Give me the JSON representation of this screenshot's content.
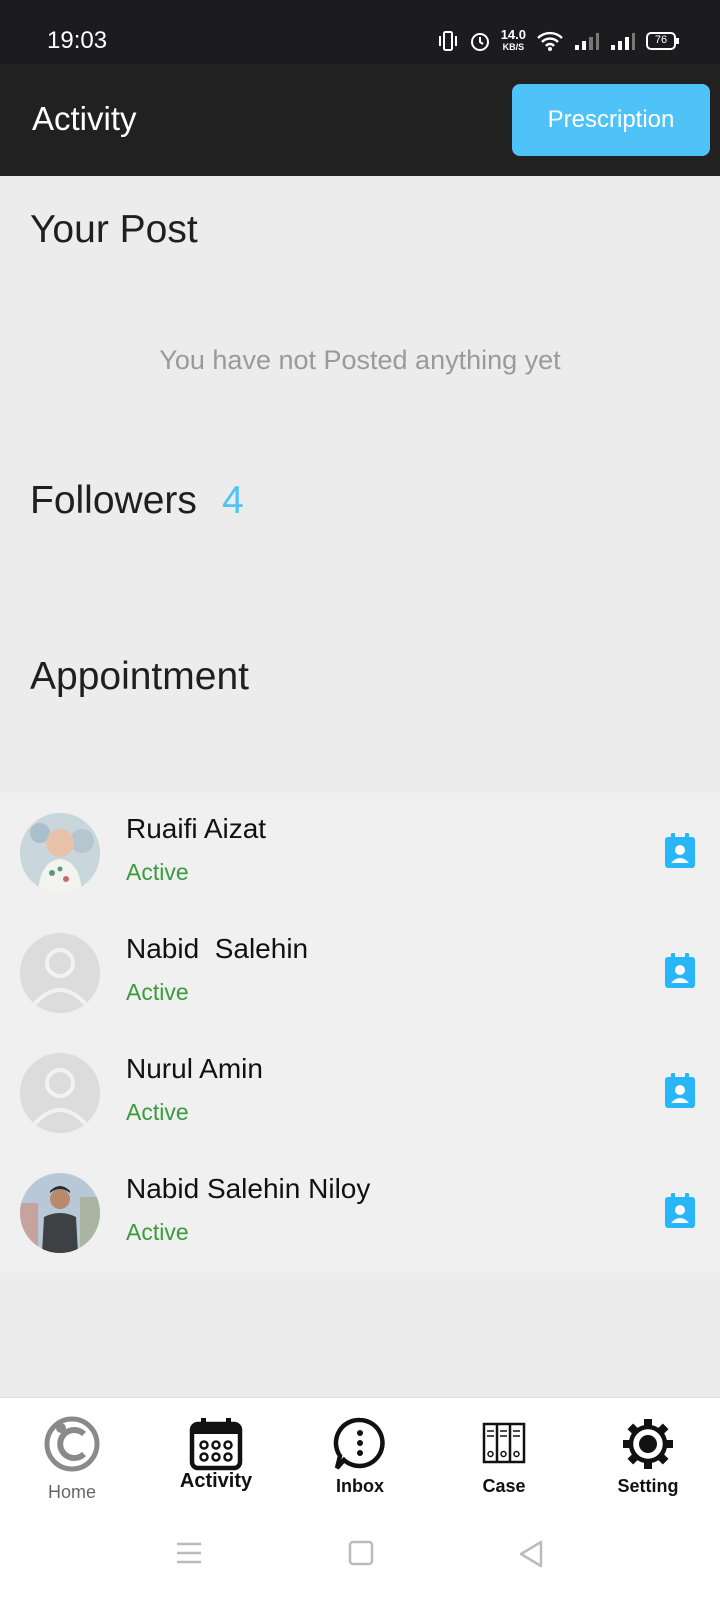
{
  "status_bar": {
    "time": "19:03",
    "net_speed_value": "14.0",
    "net_speed_unit": "KB/S",
    "battery": "76",
    "icons": [
      "vibrate-icon",
      "alarm-icon",
      "wifi-icon",
      "signal-icon",
      "signal-icon",
      "battery-icon"
    ]
  },
  "app_bar": {
    "title": "Activity",
    "prescription_label": "Prescription"
  },
  "your_post": {
    "title": "Your Post",
    "empty_message": "You have not Posted anything yet"
  },
  "followers": {
    "title": "Followers",
    "count": "4"
  },
  "appointment": {
    "title": "Appointment",
    "items": [
      {
        "name": "Ruaifi Aizat",
        "status": "Active",
        "avatar": "photo-child"
      },
      {
        "name": "Nabid  Salehin",
        "status": "Active",
        "avatar": "default-avatar"
      },
      {
        "name": "Nurul Amin",
        "status": "Active",
        "avatar": "default-avatar"
      },
      {
        "name": "Nabid Salehin Niloy",
        "status": "Active",
        "avatar": "photo-man"
      }
    ]
  },
  "bottom_nav": {
    "items": [
      {
        "label": "Home",
        "icon": "home-logo-icon"
      },
      {
        "label": "Activity",
        "icon": "calendar-icon"
      },
      {
        "label": "Inbox",
        "icon": "chat-icon"
      },
      {
        "label": "Case",
        "icon": "folders-icon"
      },
      {
        "label": "Setting",
        "icon": "gear-icon"
      }
    ]
  },
  "colors": {
    "accent": "#4fc3f7",
    "active_status": "#3b9a3b",
    "app_bar": "#212121",
    "background": "#ececec"
  }
}
